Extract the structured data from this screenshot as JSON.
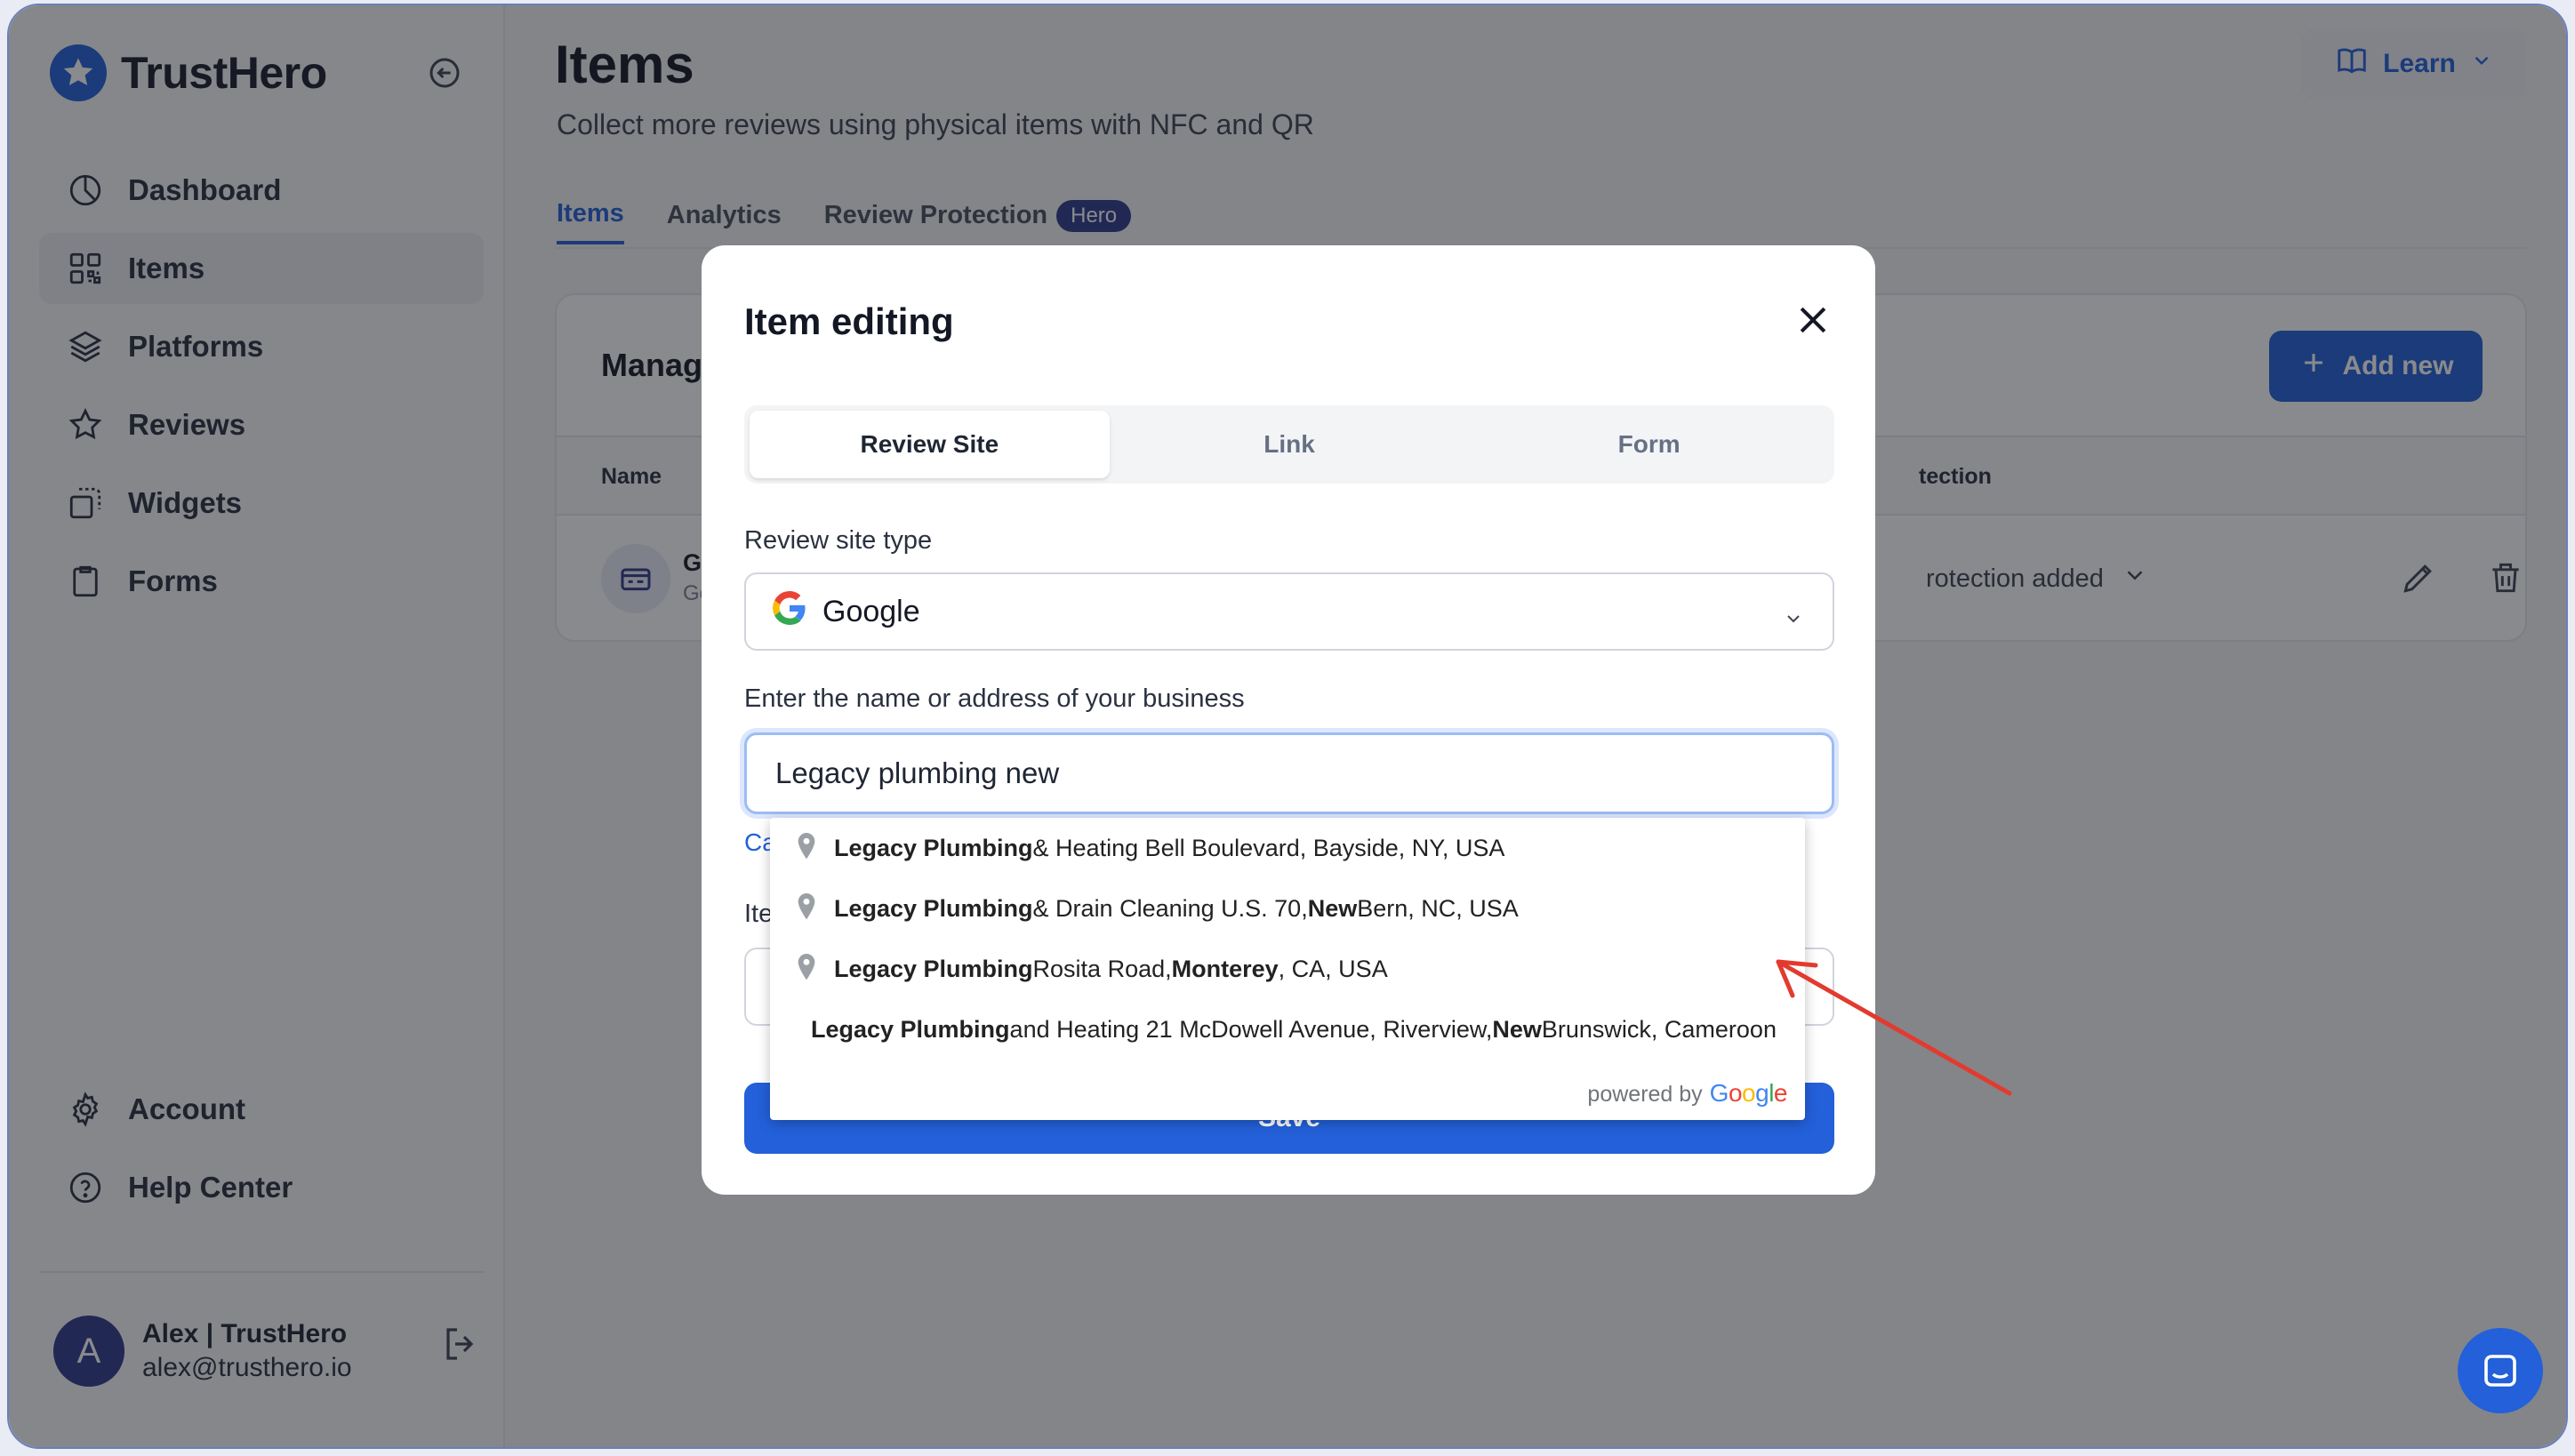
{
  "app": {
    "brand": "TrustHero",
    "brand_color": "#2360d9"
  },
  "sidebar": {
    "items": [
      {
        "label": "Dashboard",
        "icon": "pie-chart-icon"
      },
      {
        "label": "Items",
        "icon": "qr-grid-icon",
        "active": true
      },
      {
        "label": "Platforms",
        "icon": "layers-icon"
      },
      {
        "label": "Reviews",
        "icon": "star-icon"
      },
      {
        "label": "Widgets",
        "icon": "widget-icon"
      },
      {
        "label": "Forms",
        "icon": "clipboard-icon"
      }
    ],
    "bottom": [
      {
        "label": "Account",
        "icon": "gear-icon"
      },
      {
        "label": "Help Center",
        "icon": "help-circle-icon"
      }
    ],
    "user": {
      "initial": "A",
      "name": "Alex | TrustHero",
      "email": "alex@trusthero.io"
    }
  },
  "header": {
    "title": "Items",
    "subtitle": "Collect more reviews using physical items with NFC and QR",
    "learn_label": "Learn"
  },
  "tabs": [
    {
      "label": "Items",
      "active": true
    },
    {
      "label": "Analytics"
    },
    {
      "label": "Review Protection",
      "badge": "Hero"
    }
  ],
  "card": {
    "title": "Manage",
    "add_label": "Add new",
    "columns": {
      "name": "Name",
      "protection": "tection"
    },
    "row": {
      "name": "Go",
      "sub": "Go",
      "protection": "rotection added"
    }
  },
  "modal": {
    "title": "Item editing",
    "segments": [
      "Review Site",
      "Link",
      "Form"
    ],
    "active_segment": 0,
    "site_type_label": "Review site type",
    "site_type_value": "Google",
    "business_label": "Enter the name or address of your business",
    "business_value": "Legacy plumbing new",
    "hidden_link": "Ca",
    "hidden_label": "Ite",
    "save_label": "Save"
  },
  "autocomplete": {
    "results": [
      {
        "bold": "Legacy Plumbing",
        "parts": [
          {
            "t": " & Heating Bell Boulevard, Bayside, NY, USA"
          }
        ]
      },
      {
        "bold": "Legacy Plumbing",
        "parts": [
          {
            "t": " & Drain Cleaning U.S. 70, "
          },
          {
            "t": "New",
            "b": true
          },
          {
            "t": " Bern, NC, USA"
          }
        ]
      },
      {
        "bold": "Legacy Plumbing",
        "parts": [
          {
            "t": " Rosita Road, "
          },
          {
            "t": "Monterey",
            "b": true
          },
          {
            "t": ", CA, USA"
          }
        ]
      },
      {
        "bold": "Legacy Plumbing",
        "parts": [
          {
            "t": " and Heating 21 McDowell Avenue, Riverview, "
          },
          {
            "t": "New",
            "b": true
          },
          {
            "t": " Brunswick, Cameroon"
          }
        ]
      }
    ],
    "powered_by": "powered by",
    "google": "Google"
  },
  "colors": {
    "annotation_arrow": "#e23b2e",
    "overlay": "rgba(20,22,28,0.5)"
  }
}
